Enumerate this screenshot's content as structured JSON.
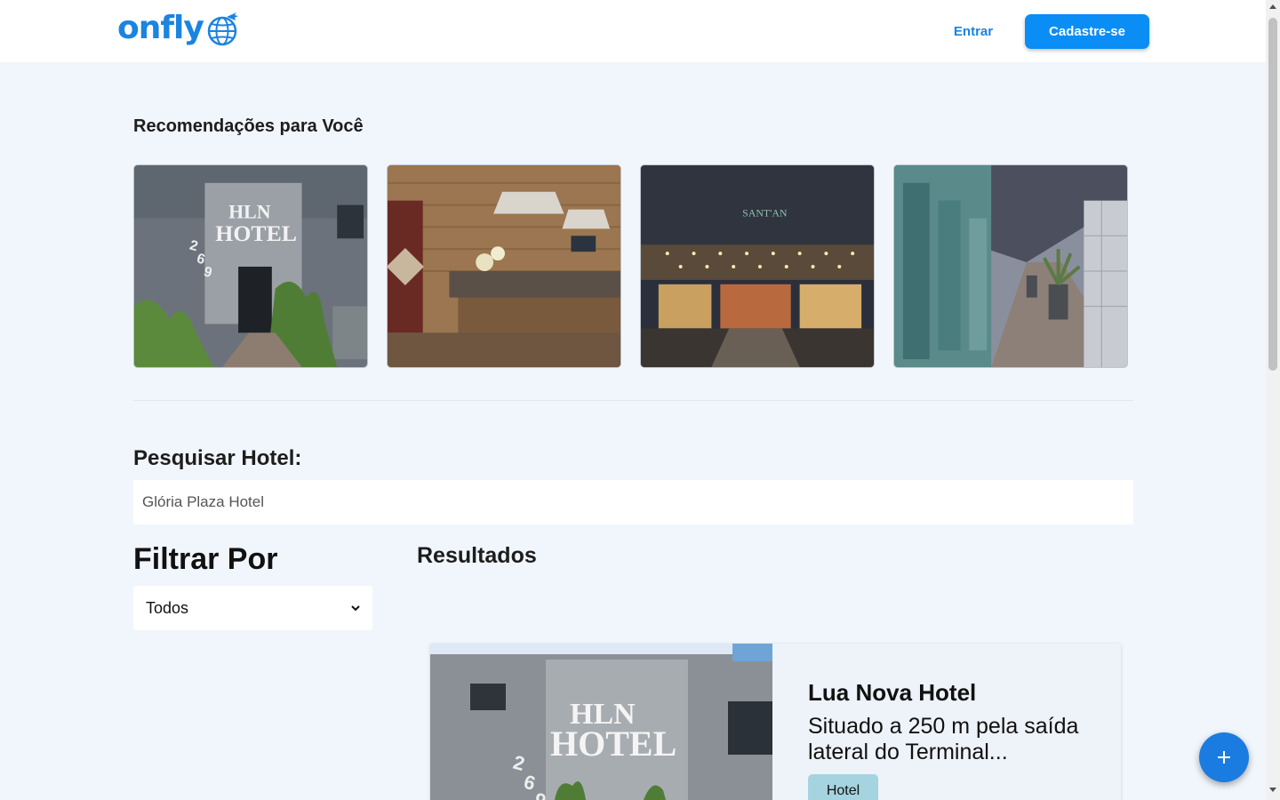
{
  "header": {
    "logo_text": "onfly",
    "login_label": "Entrar",
    "signup_label": "Cadastre-se"
  },
  "recommendations": {
    "title": "Recomendações para Você",
    "cards": [
      {
        "image": "hln-hotel-facade"
      },
      {
        "image": "hotel-reception-desk"
      },
      {
        "image": "hotel-night-entrance"
      },
      {
        "image": "hotel-balcony-corridor"
      }
    ]
  },
  "search": {
    "label": "Pesquisar Hotel:",
    "value": "Glória Plaza Hotel"
  },
  "filter": {
    "title": "Filtrar Por",
    "selected": "Todos"
  },
  "results": {
    "title": "Resultados",
    "items": [
      {
        "name": "Lua Nova Hotel",
        "description": "Situado a 250 m pela saída lateral do Terminal...",
        "tag": "Hotel",
        "image": "hln-hotel-facade"
      }
    ]
  },
  "fab": {
    "icon": "plus-icon"
  },
  "colors": {
    "brand": "#1a84e0",
    "signup_button": "#0a8ef5",
    "page_background": "#f1f6fd",
    "tag_background": "#a5d3e0",
    "fab": "#1a7ce0"
  }
}
